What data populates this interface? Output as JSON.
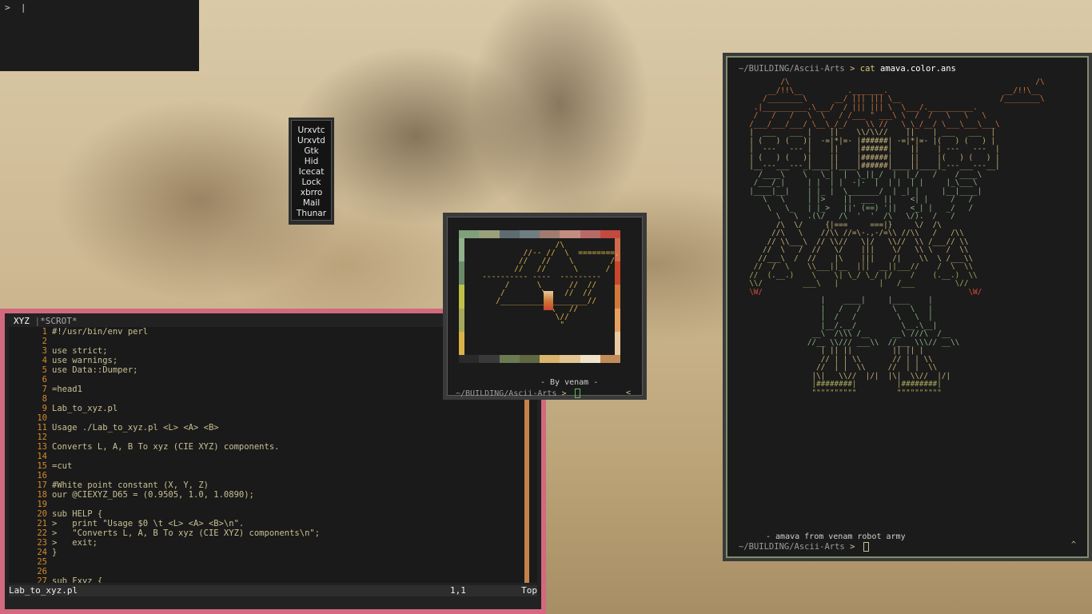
{
  "mini_terminal": {
    "prompt": ">  |"
  },
  "app_menu": {
    "items": [
      "Urxvtc",
      "Urxvtd",
      "Gtk",
      "Hid",
      "Icecat",
      "Lock",
      "xbrro",
      "Mail",
      "Thunar"
    ]
  },
  "vim": {
    "tabline": {
      "current": "XYZ",
      "separator": "|",
      "other": "*SCROT*"
    },
    "lines": [
      {
        "n": "1",
        "text": "#!/usr/bin/env perl"
      },
      {
        "n": "2",
        "text": ""
      },
      {
        "n": "3",
        "text": "use strict;"
      },
      {
        "n": "4",
        "text": "use warnings;"
      },
      {
        "n": "5",
        "text": "use Data::Dumper;"
      },
      {
        "n": "6",
        "text": ""
      },
      {
        "n": "7",
        "text": "=head1"
      },
      {
        "n": "8",
        "text": ""
      },
      {
        "n": "9",
        "text": "Lab_to_xyz.pl"
      },
      {
        "n": "10",
        "text": ""
      },
      {
        "n": "11",
        "text": "Usage ./Lab_to_xyz.pl <L> <A> <B>"
      },
      {
        "n": "12",
        "text": ""
      },
      {
        "n": "13",
        "text": "Converts L, A, B To xyz (CIE XYZ) components."
      },
      {
        "n": "14",
        "text": ""
      },
      {
        "n": "15",
        "text": "=cut"
      },
      {
        "n": "16",
        "text": ""
      },
      {
        "n": "17",
        "text": "#White point constant (X, Y, Z)"
      },
      {
        "n": "18",
        "text": "our @CIEXYZ_D65 = (0.9505, 1.0, 1.0890);"
      },
      {
        "n": "19",
        "text": ""
      },
      {
        "n": "20",
        "text": "sub HELP {"
      },
      {
        "n": "21",
        "text": ">   print \"Usage $0 \\t <L> <A> <B>\\n\"."
      },
      {
        "n": "22",
        "text": ">   \"Converts L, A, B To xyz (CIE XYZ) components\\n\";"
      },
      {
        "n": "23",
        "text": ">   exit;"
      },
      {
        "n": "24",
        "text": "}"
      },
      {
        "n": "25",
        "text": ""
      },
      {
        "n": "26",
        "text": ""
      },
      {
        "n": "27",
        "text": "sub Fxyz {"
      }
    ],
    "status": {
      "filename": "Lab_to_xyz.pl",
      "position": "1,1",
      "scroll": "Top"
    }
  },
  "small_terminal": {
    "palette_top": [
      "#7fa07a",
      "#9aa07a",
      "#5e6b6f",
      "#6f7e82",
      "#a07b70",
      "#c38d80",
      "#b86a68",
      "#c24a3f"
    ],
    "palette_bottom": [
      "#2a2a2a",
      "#3a3a3a",
      "#6b7a52",
      "#5f6840",
      "#d8b46c",
      "#e3c592",
      "#efe3c8",
      "#c28b5a"
    ],
    "palette_left": [
      "#8fb38a",
      "#6a8a6a",
      "#bfbf4a",
      "#a7a85c",
      "#d9b24a"
    ],
    "palette_right": [
      "#d06a4a",
      "#c9452c",
      "#d07a3a",
      "#e8a060",
      "#e8c9a0"
    ],
    "byline": "- By venam -",
    "prompt_path": "~/BUILDING/Ascii-Arts",
    "prompt_arrow": ">",
    "indicator": "<"
  },
  "large_terminal": {
    "prompt_path": "~/BUILDING/Ascii-Arts",
    "prompt_arrow": ">",
    "command": "cat",
    "argument": "amava.color.ans",
    "byline": "- amava from venam robot army",
    "indicator": "^"
  }
}
